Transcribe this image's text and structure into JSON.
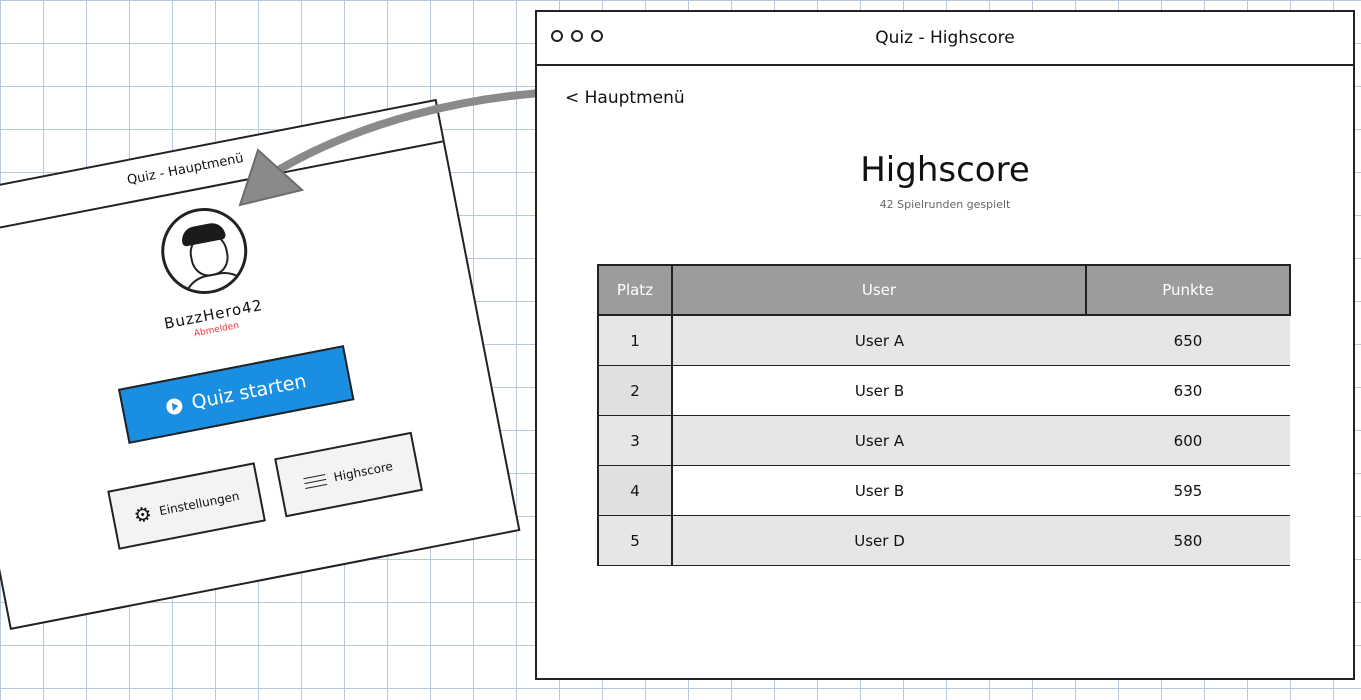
{
  "main_menu": {
    "window_title": "Quiz - Hauptmenü",
    "username": "BuzzHero42",
    "logout_label": "Abmelden",
    "start_label": "Quiz starten",
    "settings_label": "Einstellungen",
    "highscore_label": "Highscore"
  },
  "highscore_window": {
    "window_title": "Quiz - Highscore",
    "back_label": "< Hauptmenü",
    "heading": "Highscore",
    "subheading": "42 Spielrunden gespielt",
    "columns": [
      "Platz",
      "User",
      "Punkte"
    ],
    "rows": [
      {
        "place": "1",
        "user": "User A",
        "points": "650"
      },
      {
        "place": "2",
        "user": "User B",
        "points": "630"
      },
      {
        "place": "3",
        "user": "User A",
        "points": "600"
      },
      {
        "place": "4",
        "user": "User B",
        "points": "595"
      },
      {
        "place": "5",
        "user": "User D",
        "points": "580"
      }
    ]
  },
  "colors": {
    "accent": "#1a8fe2",
    "logout": "#e33333",
    "table_header": "#9c9c9c"
  }
}
